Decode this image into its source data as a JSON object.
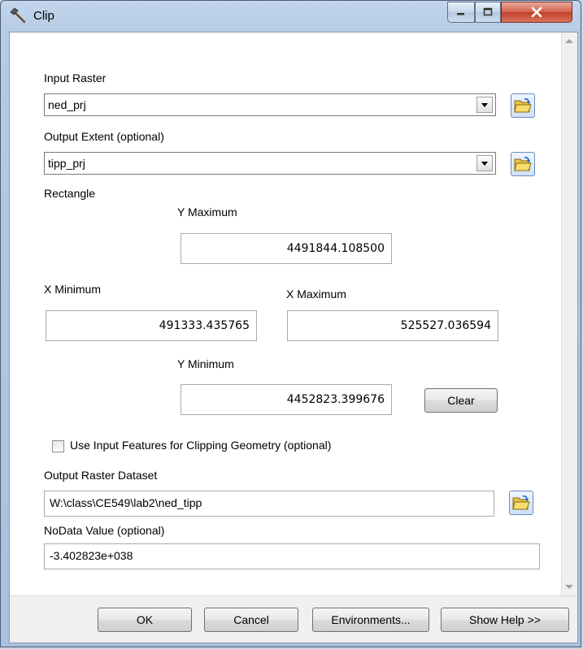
{
  "window": {
    "title": "Clip"
  },
  "form": {
    "input_raster_label": "Input Raster",
    "input_raster_value": "ned_prj",
    "output_extent_label": "Output Extent (optional)",
    "output_extent_value": "tipp_prj",
    "rectangle_label": "Rectangle",
    "y_max_label": "Y Maximum",
    "y_max_value": "4491844.108500",
    "x_min_label": "X Minimum",
    "x_min_value": "491333.435765",
    "x_max_label": "X Maximum",
    "x_max_value": "525527.036594",
    "y_min_label": "Y Minimum",
    "y_min_value": "4452823.399676",
    "clear_label": "Clear",
    "use_input_features_label": "Use Input Features for Clipping Geometry (optional)",
    "use_input_features_checked": false,
    "output_raster_label": "Output Raster Dataset",
    "output_raster_value": "W:\\class\\CE549\\lab2\\ned_tipp",
    "nodata_label": "NoData Value (optional)",
    "nodata_value": "-3.402823e+038"
  },
  "buttons": {
    "ok": "OK",
    "cancel": "Cancel",
    "environments": "Environments...",
    "show_help": "Show Help >>"
  },
  "icons": {
    "title": "hammer-icon",
    "browse": "open-folder-icon"
  },
  "colors": {
    "close_button": "#c2402a",
    "title_bar": "#b6cbe4"
  }
}
